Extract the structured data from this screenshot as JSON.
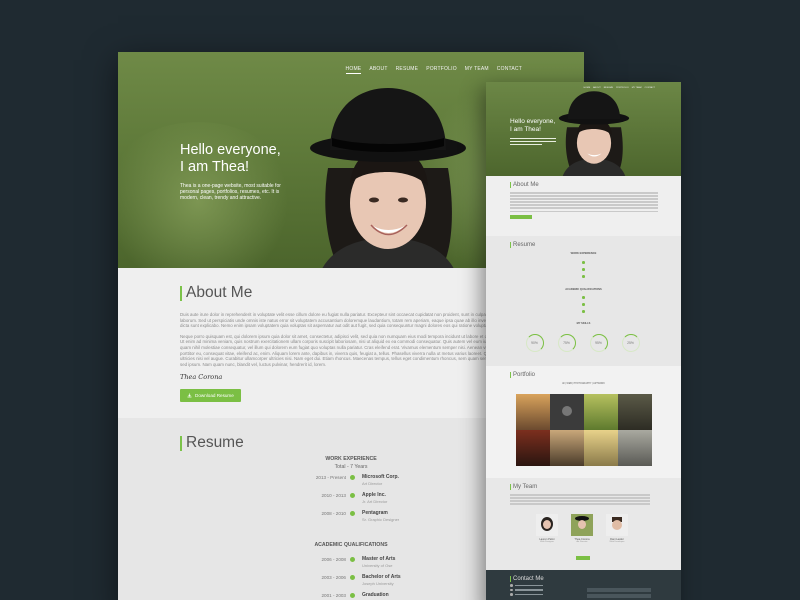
{
  "big": {
    "nav": [
      "HOME",
      "ABOUT",
      "RESUME",
      "PORTFOLIO",
      "MY TEAM",
      "CONTACT"
    ],
    "hero": {
      "title_line1": "Hello everyone,",
      "title_line2": "I am Thea!",
      "subtitle": "Thea is a one-page website, most suitable for personal pages, portfolios, resumes, etc. It is modern, clean, trendy and attractive."
    },
    "about": {
      "title": "About Me",
      "para1": "Duis aute irure dolor in reprehenderit in voluptate velit esse cillum dolore eu fugiat nulla pariatur. Excepteur sint occaecat cupidatat non proident, sunt in culpa qui officia deserunt mollit anim id est laborum. Sed ut perspiciatis unde omnis iste natus error sit voluptatem accusantium doloremque laudantium, totam rem aperiam, eaque ipsa quae ab illo inventore veritatis et quasi architecto beatae vitae dicta sunt explicabo. Nemo enim ipsam voluptatem quia voluptas sit aspernatur aut odit aut fugit, sed quia consequuntur magni dolores eos qui ratione voluptatem sequi nesciunt.",
      "para2": "Neque porro quisquam est, qui dolorem ipsum quia dolor sit amet, consectetur, adipisci velit, sed quia non numquam eius modi tempora incidunt ut labore et dolore magnam aliquam quaerat voluptatem. Ut enim ad minima veniam, quis nostrum exercitationem ullam corporis suscipit laboriosam, nisi ut aliquid ex ea commodi consequatur. Quis autem vel eum iure reprehenderit qui in ea voluptate velit esse quam nihil molestiae consequatur, vel illum qui dolorem eum fugiat quo voluptas nulla pariatur. Cras eleifend erat. Vivamus elementum semper nisi. Aenean vulputate eleifend tellus. Aenean leo ligula, porttitor eu, consequat vitae, eleifend ac, enim. Aliquam lorem ante, dapibus in, viverra quis, feugiat a, tellus. Phasellus viverra nulla ut metus varius laoreet. Quisque rutrum. Aenean imperdiet. Etiam ultricies nisi vel augue. Curabitur ullamcorper ultricies nisi. Nam eget dui. Etiam rhoncus. Maecenas tempus, tellus eget condimentum rhoncus, sem quam semper libero, sit amet adipiscing sem neque sed ipsum. Nam quam nunc, blandit vel, luctus pulvinar, hendrerit id, lorem.",
      "signature": "Thea Corona",
      "button": "Download Resume"
    },
    "resume": {
      "title": "Resume",
      "work_heading": "WORK EXPERIENCE",
      "work_sub": "Total - 7 Years",
      "work": [
        {
          "date": "2013 - Present",
          "title": "Microsoft Corp.",
          "role": "Art Director"
        },
        {
          "date": "2010 - 2013",
          "title": "Apple Inc.",
          "role": "Jr. Art Director"
        },
        {
          "date": "2008 - 2010",
          "title": "Pentagram",
          "role": "Sr. Graphic Designer"
        }
      ],
      "edu_heading": "ACADEMIC QUALIFICATIONS",
      "edu": [
        {
          "date": "2006 - 2008",
          "title": "Master of Arts",
          "role": "University of Ose"
        },
        {
          "date": "2003 - 2006",
          "title": "Bachelor of Arts",
          "role": "Joseph University"
        },
        {
          "date": "2001 - 2003",
          "title": "Graduation",
          "role": "Charles College"
        }
      ]
    }
  },
  "small": {
    "nav": [
      "HOME",
      "ABOUT",
      "RESUME",
      "PORTFOLIO",
      "MY TEAM",
      "CONTACT"
    ],
    "hero_line1": "Hello everyone,",
    "hero_line2": "I am Thea!",
    "about_title": "About Me",
    "resume_title": "Resume",
    "work_heading": "WORK EXPERIENCE",
    "edu_heading": "ACADEMIC QUALIFICATIONS",
    "skills_heading": "MY SKILLS",
    "skills": [
      "90%",
      "75%",
      "95%",
      "25%"
    ],
    "portfolio_title": "Portfolio",
    "filters": "All  |  WEB  |  PHOTOGRAPHY  |  ARTWORK",
    "team_title": "My Team",
    "team": [
      {
        "name": "Lauren Palmi",
        "role": "Web Designer"
      },
      {
        "name": "Thea Corona",
        "role": "Art Director"
      },
      {
        "name": "Dani Lawler",
        "role": "Web Developer"
      }
    ],
    "contact_title": "Contact Me"
  },
  "colors": {
    "background": "#1f2a31",
    "accent": "#7bbf44",
    "hero_green": "#5f7a3a"
  }
}
